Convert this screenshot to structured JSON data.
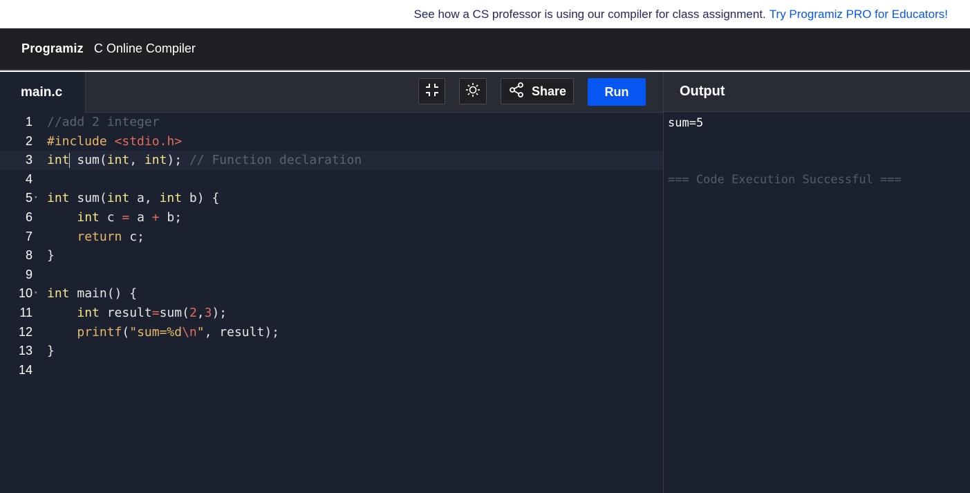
{
  "promo": {
    "text": "See how a CS professor is using our compiler for class assignment.",
    "link": "Try Programiz PRO for Educators!"
  },
  "header": {
    "logo": "Programiz",
    "title": "C Online Compiler"
  },
  "editor": {
    "file_tab": "main.c",
    "toolbar": {
      "fullscreen_icon": "collapse-icon",
      "theme_icon": "sun-icon",
      "share_label": "Share",
      "run_label": "Run"
    },
    "line_numbers": [
      "1",
      "2",
      "3",
      "4",
      "5",
      "6",
      "7",
      "8",
      "9",
      "10",
      "11",
      "12",
      "13",
      "14"
    ],
    "active_line": 3,
    "fold_lines": [
      5,
      10
    ],
    "lines": [
      [
        [
          "com",
          "//add 2 integer"
        ]
      ],
      [
        [
          "pre",
          "#include "
        ],
        [
          "inc",
          "<stdio.h>"
        ]
      ],
      [
        [
          "kw",
          "int"
        ],
        [
          "txt",
          " sum("
        ],
        [
          "kw",
          "int"
        ],
        [
          "txt",
          ", "
        ],
        [
          "kw",
          "int"
        ],
        [
          "txt",
          "); "
        ],
        [
          "com",
          "// Function declaration"
        ]
      ],
      [],
      [
        [
          "kw",
          "int"
        ],
        [
          "txt",
          " sum("
        ],
        [
          "kw",
          "int"
        ],
        [
          "txt",
          " a, "
        ],
        [
          "kw",
          "int"
        ],
        [
          "txt",
          " b) {"
        ]
      ],
      [
        [
          "txt",
          "    "
        ],
        [
          "kw",
          "int"
        ],
        [
          "txt",
          " c "
        ],
        [
          "op",
          "="
        ],
        [
          "txt",
          " a "
        ],
        [
          "op",
          "+"
        ],
        [
          "txt",
          " b;"
        ]
      ],
      [
        [
          "txt",
          "    "
        ],
        [
          "ret",
          "return"
        ],
        [
          "txt",
          " c;"
        ]
      ],
      [
        [
          "txt",
          "}"
        ]
      ],
      [],
      [
        [
          "kw",
          "int"
        ],
        [
          "txt",
          " main() {"
        ]
      ],
      [
        [
          "txt",
          "    "
        ],
        [
          "kw",
          "int"
        ],
        [
          "txt",
          " result"
        ],
        [
          "op",
          "="
        ],
        [
          "txt",
          "sum("
        ],
        [
          "num",
          "2"
        ],
        [
          "txt",
          ","
        ],
        [
          "num",
          "3"
        ],
        [
          "txt",
          ");"
        ]
      ],
      [
        [
          "txt",
          "    "
        ],
        [
          "ret",
          "printf"
        ],
        [
          "txt",
          "("
        ],
        [
          "str",
          "\"sum=%d"
        ],
        [
          "esc",
          "\\n"
        ],
        [
          "str",
          "\""
        ],
        [
          "txt",
          ", result);"
        ]
      ],
      [
        [
          "txt",
          "}"
        ]
      ],
      []
    ]
  },
  "output": {
    "title": "Output",
    "result": "sum=5",
    "status": "=== Code Execution Successful ==="
  },
  "colors": {
    "accent": "#0556f3",
    "editor_bg": "#1c2130",
    "toolbar_bg": "#2a2c35"
  }
}
